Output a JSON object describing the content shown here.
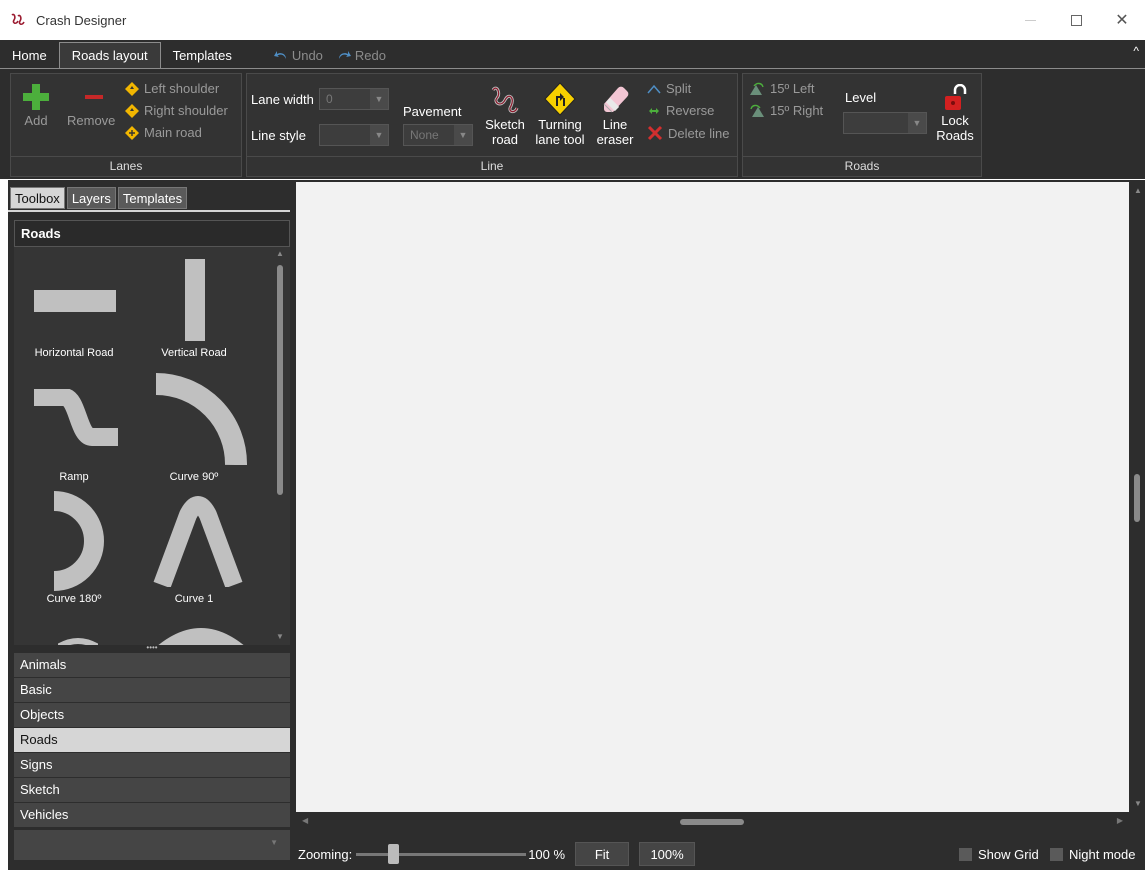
{
  "window": {
    "title": "Crash Designer"
  },
  "tabs": [
    "Home",
    "Roads layout",
    "Templates"
  ],
  "undo_label": "Undo",
  "redo_label": "Redo",
  "ribbon": {
    "lanes": {
      "add": "Add",
      "remove": "Remove",
      "left_shoulder": "Left shoulder",
      "right_shoulder": "Right shoulder",
      "main_road": "Main road",
      "group_label": "Lanes"
    },
    "line": {
      "lane_width_label": "Lane width",
      "lane_width_value": "0",
      "line_style_label": "Line style",
      "line_style_value": "",
      "pavement_label": "Pavement",
      "pavement_value": "None",
      "sketch_road_1": "Sketch",
      "sketch_road_2": "road",
      "turning_1": "Turning",
      "turning_2": "lane tool",
      "eraser_1": "Line",
      "eraser_2": "eraser",
      "split": "Split",
      "reverse": "Reverse",
      "delete_line": "Delete line",
      "group_label": "Line"
    },
    "roads": {
      "left15": "15º Left",
      "right15": "15º Right",
      "level_label": "Level",
      "level_value": "",
      "lock_1": "Lock",
      "lock_2": "Roads",
      "group_label": "Roads"
    }
  },
  "panel": {
    "tabs": [
      "Toolbox",
      "Layers",
      "Templates"
    ],
    "section_header": "Roads",
    "tools": [
      "Horizontal Road",
      "Vertical Road",
      "Ramp",
      "Curve 90º",
      "Curve 180º",
      "Curve 1"
    ],
    "categories": [
      "Animals",
      "Basic",
      "Objects",
      "Roads",
      "Signs",
      "Sketch",
      "Vehicles"
    ],
    "active_category": "Roads",
    "splitter_grip": "••••"
  },
  "status": {
    "zoom_label": "Zooming:",
    "zoom_value": "100 %",
    "zoom_level": 0.2,
    "fit_label": "Fit",
    "hundred_label": "100%",
    "show_grid": "Show Grid",
    "night_mode": "Night mode"
  }
}
